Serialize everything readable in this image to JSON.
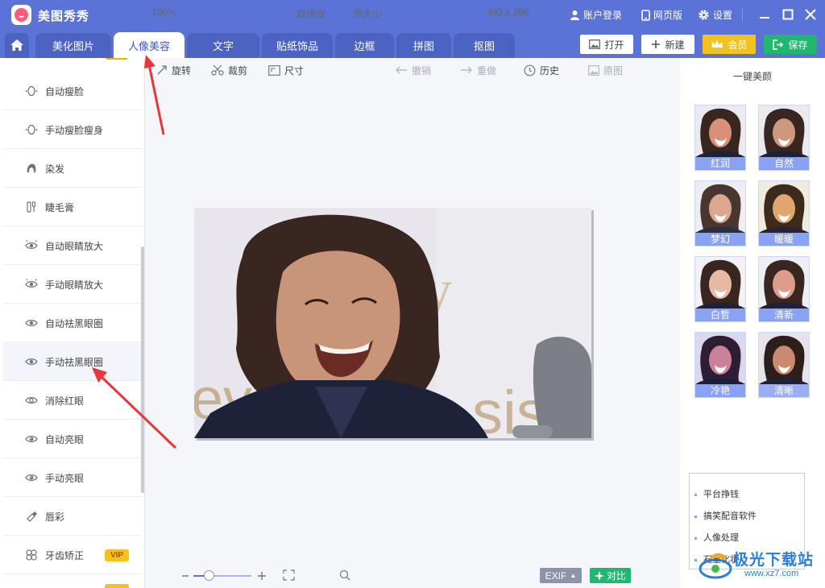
{
  "app": {
    "name": "美图秀秀"
  },
  "titlebar": {
    "login": "账户登录",
    "web": "网页版",
    "settings": "设置"
  },
  "tabs": [
    "美化图片",
    "人像美容",
    "文字",
    "贴纸饰品",
    "边框",
    "拼图",
    "抠图"
  ],
  "active_tab": "人像美容",
  "actions": {
    "open": "打开",
    "new": "新建",
    "vip": "会员",
    "save": "保存"
  },
  "sidebar": {
    "items": [
      {
        "label": "自动瘦脸",
        "icon": "face-slim-icon"
      },
      {
        "label": "手动瘦脸瘦身",
        "icon": "face-slim-icon"
      },
      {
        "label": "染发",
        "icon": "hair-dye-icon"
      },
      {
        "label": "睫毛膏",
        "icon": "mascara-icon"
      },
      {
        "label": "自动眼睛放大",
        "icon": "eye-enlarge-icon"
      },
      {
        "label": "手动眼睛放大",
        "icon": "eye-enlarge-icon"
      },
      {
        "label": "自动祛黑眼圈",
        "icon": "eye-icon"
      },
      {
        "label": "手动祛黑眼圈",
        "icon": "eye-icon"
      },
      {
        "label": "消除红眼",
        "icon": "eye-icon"
      },
      {
        "label": "自动亮眼",
        "icon": "eye-bright-icon"
      },
      {
        "label": "手动亮眼",
        "icon": "eye-bright-icon"
      },
      {
        "label": "唇彩",
        "icon": "lipstick-icon"
      },
      {
        "label": "牙齿矫正",
        "icon": "teeth-icon",
        "badge": "VIP"
      }
    ],
    "selected": "手动祛黑眼圈"
  },
  "toolbar": {
    "rotate": "旋转",
    "crop": "裁剪",
    "size": "尺寸",
    "undo": "撤销",
    "redo": "重做",
    "history": "历史",
    "original": "原图"
  },
  "right_panel": {
    "title": "一键美颜",
    "presets": [
      "红润",
      "自然",
      "梦幻",
      "暖暖",
      "白皙",
      "清新",
      "冷艳",
      "清晰"
    ]
  },
  "ads": [
    "平台挣钱",
    "搞笑配音软件",
    "人像处理",
    "石墨化妆"
  ],
  "statusbar": {
    "zoom": "100%",
    "zoom_level": 0.27,
    "fit": "自适应",
    "original_size": "原大小",
    "dimensions": "493 x 286",
    "exif": "EXIF",
    "compare": "对比"
  },
  "watermark": {
    "text": "极光下载站",
    "url": "www.xz7.com"
  },
  "colors": {
    "brand": "#5b73d6",
    "save": "#22b76f",
    "vip": "#f5c21d",
    "annotation_arrow": "#e8363d"
  }
}
